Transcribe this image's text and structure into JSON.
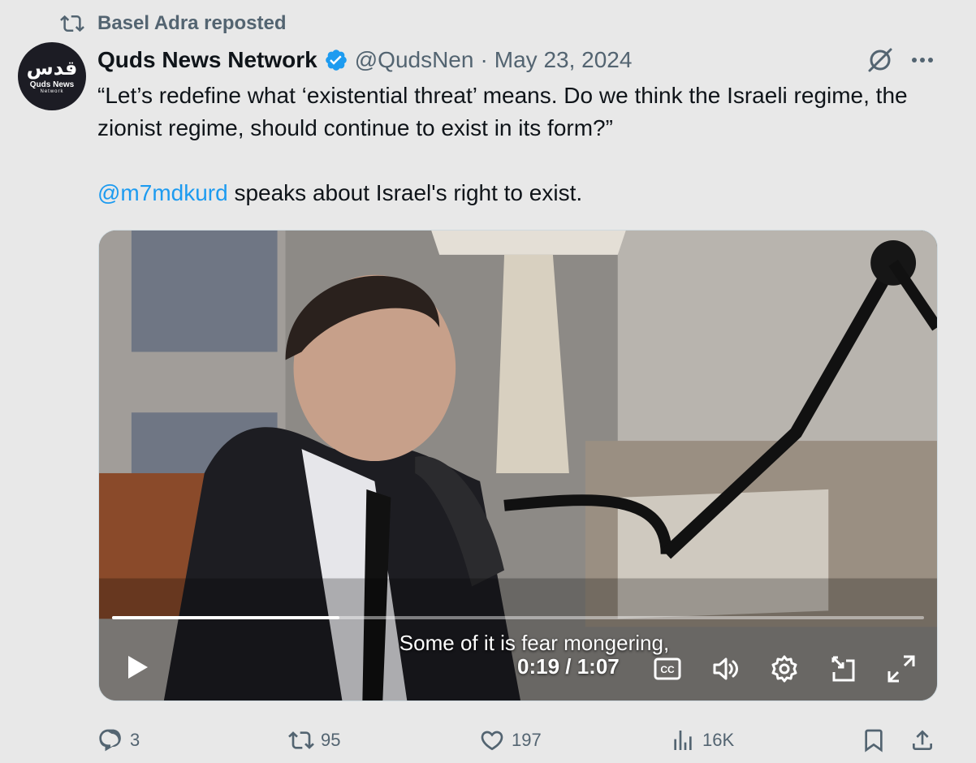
{
  "repost": {
    "text": "Basel Adra reposted",
    "icon": "repost-icon"
  },
  "author": {
    "name": "Quds News Network",
    "handle": "@QudsNen",
    "separator": "·",
    "date": "May 23, 2024",
    "verified": true,
    "avatar": {
      "glyph": "قدس",
      "line1": "Quds News",
      "line2": "Network"
    }
  },
  "tweet": {
    "quote": "“Let’s redefine what ‘existential threat’ means. Do we think the Israeli regime, the zionist regime, should continue to exist in its form?”",
    "mention": "@m7mdkurd",
    "after_mention": " speaks about Israel's right to exist."
  },
  "video": {
    "caption": "Some of it is fear mongering,",
    "time": "0:19 / 1:07",
    "progress": 0.28,
    "controls": [
      "play-icon",
      "captions-icon",
      "volume-icon",
      "settings-icon",
      "pip-icon",
      "fullscreen-icon"
    ]
  },
  "actions": {
    "replies": "3",
    "reposts": "95",
    "likes": "197",
    "views": "16K"
  },
  "colors": {
    "background": "#e8e8e8",
    "text": "#0f1419",
    "secondary": "#536471",
    "link": "#1d9bf0",
    "verified": "#1d9bf0"
  }
}
